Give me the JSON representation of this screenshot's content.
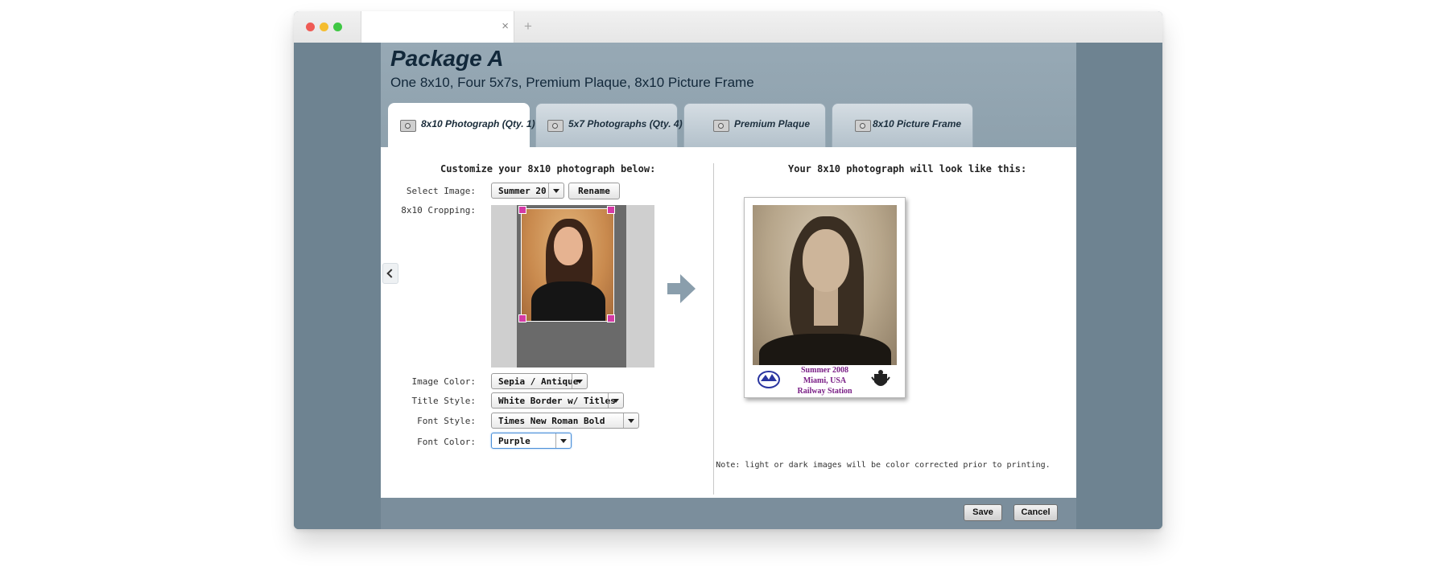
{
  "browser": {
    "tab_close": "×",
    "tab_new": "+"
  },
  "package": {
    "title": "Package A",
    "subtitle": "One 8x10, Four 5x7s, Premium Plaque, 8x10 Picture Frame"
  },
  "tabs": [
    {
      "label": "8x10 Photograph (Qty. 1)",
      "active": true
    },
    {
      "label": "5x7 Photographs (Qty. 4)",
      "active": false
    },
    {
      "label": "Premium Plaque",
      "active": false
    },
    {
      "label": "8x10 Picture Frame",
      "active": false
    }
  ],
  "left": {
    "heading": "Customize your 8x10 photograph below:",
    "select_image_label": "Select Image:",
    "select_image_value": "Summer 20",
    "rename_label": "Rename",
    "cropping_label": "8x10 Cropping:",
    "image_color_label": "Image Color:",
    "image_color_value": "Sepia / Antique",
    "title_style_label": "Title Style:",
    "title_style_value": "White Border w/ Titles",
    "font_style_label": "Font Style:",
    "font_style_value": "Times New Roman Bold",
    "font_color_label": "Font Color:",
    "font_color_value": "Purple"
  },
  "right": {
    "heading": "Your 8x10 photograph will look like this:",
    "caption_line1": "Summer 2008",
    "caption_line2": "Miami, USA",
    "caption_line3": "Railway Station",
    "note": "Note: light or dark images will be color corrected prior to printing."
  },
  "footer": {
    "save_label": "Save",
    "cancel_label": "Cancel"
  },
  "colors": {
    "accent": "#8ea1ad",
    "background": "#6e8391",
    "caption": "#7a1f86",
    "crop_handle": "#d43aa6"
  },
  "icons": [
    "camera-icon",
    "chevron-left-icon",
    "arrow-right-icon",
    "dropdown-arrow-icon"
  ]
}
